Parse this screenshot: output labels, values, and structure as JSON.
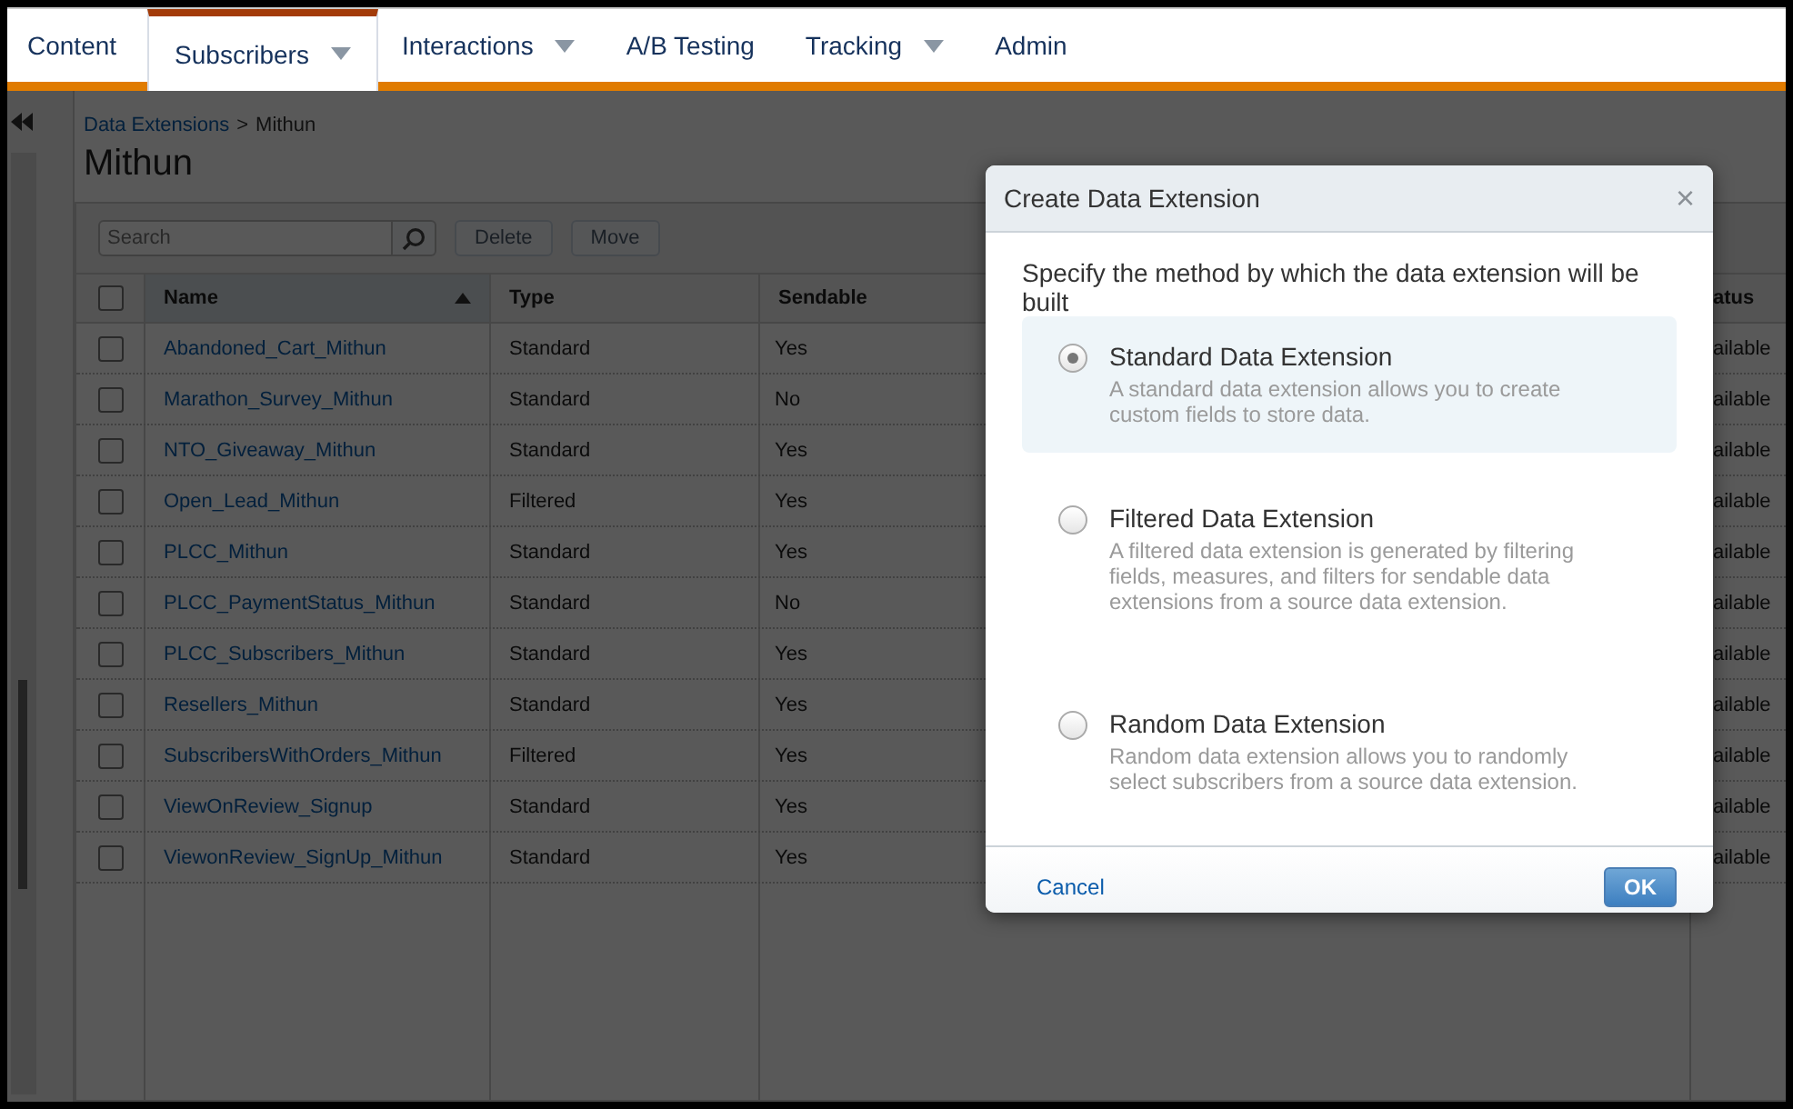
{
  "nav": {
    "tabs": [
      {
        "label": "Content",
        "selected": false,
        "has_menu": false
      },
      {
        "label": "Subscribers",
        "selected": true,
        "has_menu": true
      },
      {
        "label": "Interactions",
        "selected": false,
        "has_menu": true
      },
      {
        "label": "A/B Testing",
        "selected": false,
        "has_menu": false
      },
      {
        "label": "Tracking",
        "selected": false,
        "has_menu": true
      },
      {
        "label": "Admin",
        "selected": false,
        "has_menu": false
      }
    ]
  },
  "breadcrumb": {
    "link": "Data Extensions",
    "separator": ">",
    "current": "Mithun"
  },
  "title": "Mithun",
  "toolbar": {
    "search": {
      "placeholder": "Search"
    },
    "buttons": [
      "Delete",
      "Move"
    ]
  },
  "table": {
    "header_checked": false,
    "columns": [
      {
        "label": "Name",
        "sorted": true
      },
      {
        "label": "Type",
        "sorted": false
      },
      {
        "label": "Sendable",
        "sorted": false
      },
      {
        "label": "atus",
        "sorted": false
      }
    ],
    "rows": [
      {
        "checked": false,
        "name": "Abandoned_Cart_Mithun",
        "type": "Standard",
        "sendable": "Yes",
        "status": "ailable"
      },
      {
        "checked": false,
        "name": "Marathon_Survey_Mithun",
        "type": "Standard",
        "sendable": "No",
        "status": "ailable"
      },
      {
        "checked": false,
        "name": "NTO_Giveaway_Mithun",
        "type": "Standard",
        "sendable": "Yes",
        "status": "ailable"
      },
      {
        "checked": false,
        "name": "Open_Lead_Mithun",
        "type": "Filtered",
        "sendable": "Yes",
        "status": "ailable"
      },
      {
        "checked": false,
        "name": "PLCC_Mithun",
        "type": "Standard",
        "sendable": "Yes",
        "status": "ailable"
      },
      {
        "checked": false,
        "name": "PLCC_PaymentStatus_Mithun",
        "type": "Standard",
        "sendable": "No",
        "status": "ailable"
      },
      {
        "checked": false,
        "name": "PLCC_Subscribers_Mithun",
        "type": "Standard",
        "sendable": "Yes",
        "status": "ailable"
      },
      {
        "checked": false,
        "name": "Resellers_Mithun",
        "type": "Standard",
        "sendable": "Yes",
        "status": "ailable"
      },
      {
        "checked": false,
        "name": "SubscribersWithOrders_Mithun",
        "type": "Filtered",
        "sendable": "Yes",
        "status": "ailable"
      },
      {
        "checked": false,
        "name": "ViewOnReview_Signup",
        "type": "Standard",
        "sendable": "Yes",
        "status": "ailable"
      },
      {
        "checked": false,
        "name": "ViewonReview_SignUp_Mithun",
        "type": "Standard",
        "sendable": "Yes",
        "status": "ailable"
      }
    ]
  },
  "dialog": {
    "title": "Create Data Extension",
    "close": "×",
    "prompt": "Specify the method by which the data extension will be built",
    "options": [
      {
        "title": "Standard Data Extension",
        "description": "A standard data extension allows you to create custom fields to store data.",
        "selected": true
      },
      {
        "title": "Filtered Data Extension",
        "description": "A filtered data extension is generated by filtering fields, measures, and filters for sendable data extensions from a source data extension.",
        "selected": false
      },
      {
        "title": "Random Data Extension",
        "description": "Random data extension allows you to randomly select subscribers from a source data extension.",
        "selected": false
      }
    ],
    "cancel": "Cancel",
    "ok": "OK"
  }
}
